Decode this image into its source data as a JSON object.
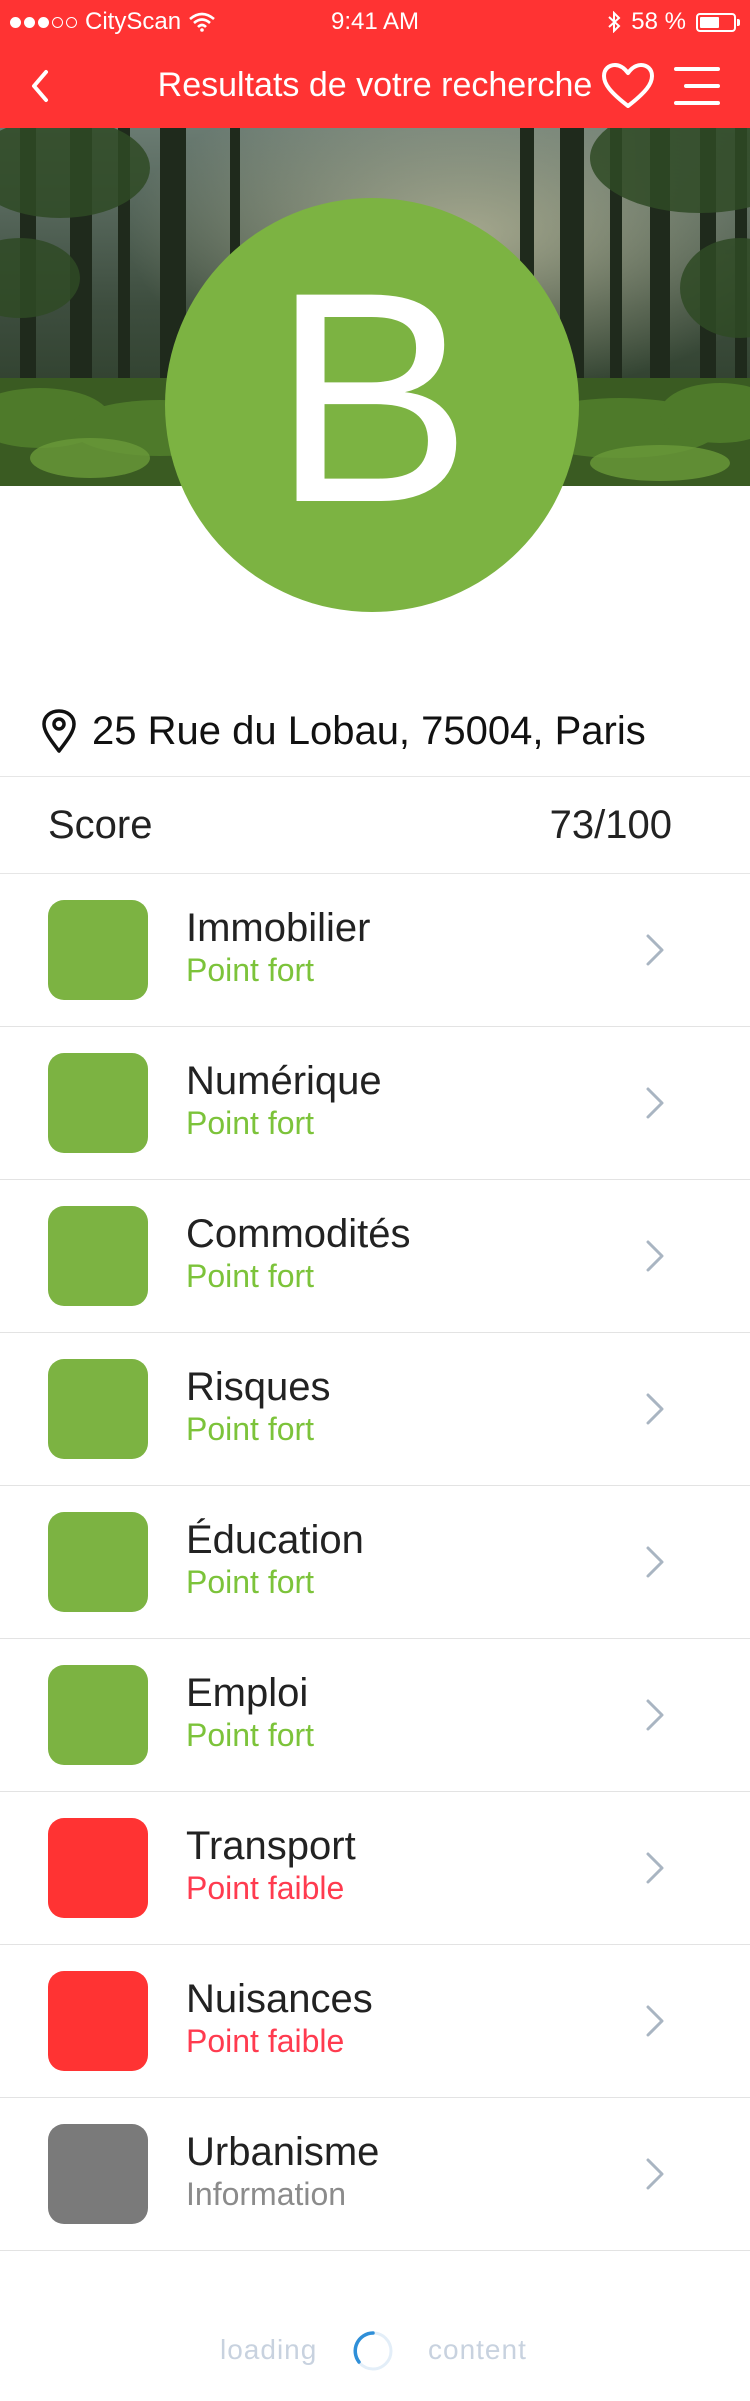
{
  "status_bar": {
    "carrier": "CityScan",
    "time": "9:41 AM",
    "battery": "58 %"
  },
  "nav": {
    "title": "Resultats de votre recherche",
    "back_icon": "chevron-left-icon",
    "favorite_icon": "heart-icon",
    "menu_icon": "menu-icon"
  },
  "grade": {
    "letter": "B",
    "color": "#7cb342"
  },
  "address": {
    "icon": "location-pin-icon",
    "text": "25 Rue du Lobau, 75004, Paris"
  },
  "score": {
    "label": "Score",
    "value": "73/100"
  },
  "categories": [
    {
      "name": "Immobilier",
      "status": "Point fort",
      "level": "strong",
      "color": "#7cb342"
    },
    {
      "name": "Numérique",
      "status": "Point fort",
      "level": "strong",
      "color": "#7cb342"
    },
    {
      "name": "Commodités",
      "status": "Point fort",
      "level": "strong",
      "color": "#7cb342"
    },
    {
      "name": "Risques",
      "status": "Point fort",
      "level": "strong",
      "color": "#7cb342"
    },
    {
      "name": "Éducation",
      "status": "Point fort",
      "level": "strong",
      "color": "#7cb342"
    },
    {
      "name": "Emploi",
      "status": "Point fort",
      "level": "strong",
      "color": "#7cb342"
    },
    {
      "name": "Transport",
      "status": "Point faible",
      "level": "weak",
      "color": "#ff3333"
    },
    {
      "name": "Nuisances",
      "status": "Point faible",
      "level": "weak",
      "color": "#ff3333"
    },
    {
      "name": "Urbanisme",
      "status": "Information",
      "level": "info",
      "color": "#7a7a7a"
    }
  ],
  "footer": {
    "left": "loading",
    "right": "content"
  },
  "colors": {
    "brand": "#ff3333",
    "strong": "#7cc33a",
    "weak": "#ff3b4f",
    "info": "#8b8b8b"
  }
}
